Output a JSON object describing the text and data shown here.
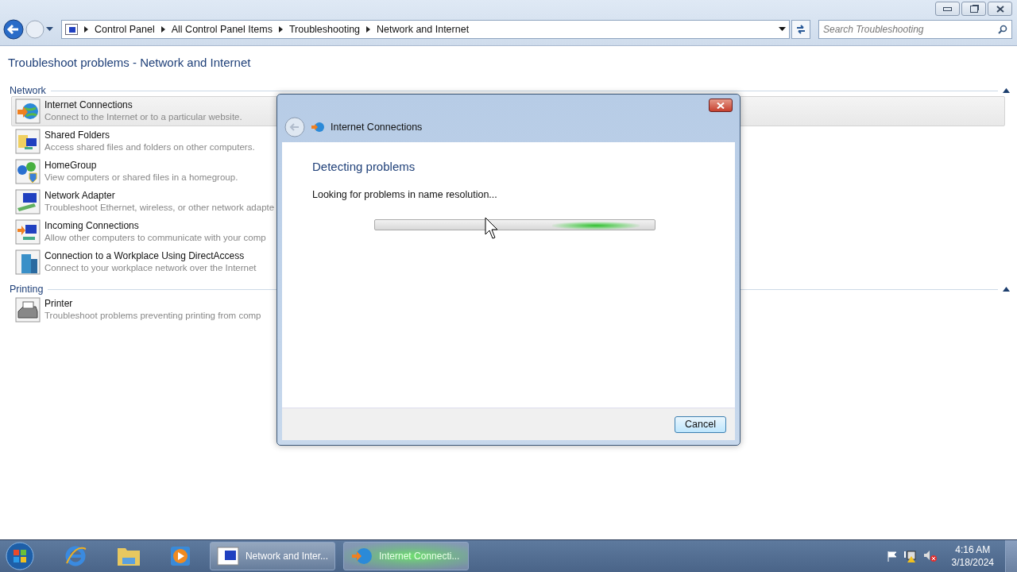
{
  "window": {
    "breadcrumb": [
      "Control Panel",
      "All Control Panel Items",
      "Troubleshooting",
      "Network and Internet"
    ],
    "search": {
      "placeholder": "Search Troubleshooting"
    }
  },
  "page_title": "Troubleshoot problems - Network and Internet",
  "sections": [
    {
      "title": "Network",
      "items": [
        {
          "kind": "globe",
          "name": "Internet Connections",
          "description": "Connect to the Internet or to a particular website.",
          "selected": true
        },
        {
          "kind": "folder",
          "name": "Shared Folders",
          "description": "Access shared files and folders on other computers.",
          "selected": false
        },
        {
          "kind": "homegroup",
          "name": "HomeGroup",
          "description": "View computers or shared files in a homegroup.",
          "selected": false
        },
        {
          "kind": "adapter",
          "name": "Network Adapter",
          "description": "Troubleshoot Ethernet, wireless, or other network adapte",
          "selected": false
        },
        {
          "kind": "incoming",
          "name": "Incoming Connections",
          "description": "Allow other computers to communicate with your comp",
          "selected": false
        },
        {
          "kind": "building",
          "name": "Connection to a Workplace Using DirectAccess",
          "description": "Connect to your workplace network over the Internet",
          "selected": false
        }
      ]
    },
    {
      "title": "Printing",
      "items": [
        {
          "kind": "printer",
          "name": "Printer",
          "description": "Troubleshoot problems preventing printing from comp",
          "selected": false
        }
      ]
    }
  ],
  "dialog": {
    "title": "Internet Connections",
    "heading": "Detecting problems",
    "status": "Looking for problems in name resolution...",
    "progress": {
      "level": 0.79
    },
    "buttons": [
      "Cancel"
    ]
  },
  "taskbar": {
    "apps": [
      {
        "kind": "explorer",
        "label": "Network and Inter...",
        "selected": false
      },
      {
        "kind": "globe",
        "label": "Internet Connecti...",
        "selected": true
      }
    ],
    "time": "4:16 AM",
    "date": "3/18/2024"
  }
}
